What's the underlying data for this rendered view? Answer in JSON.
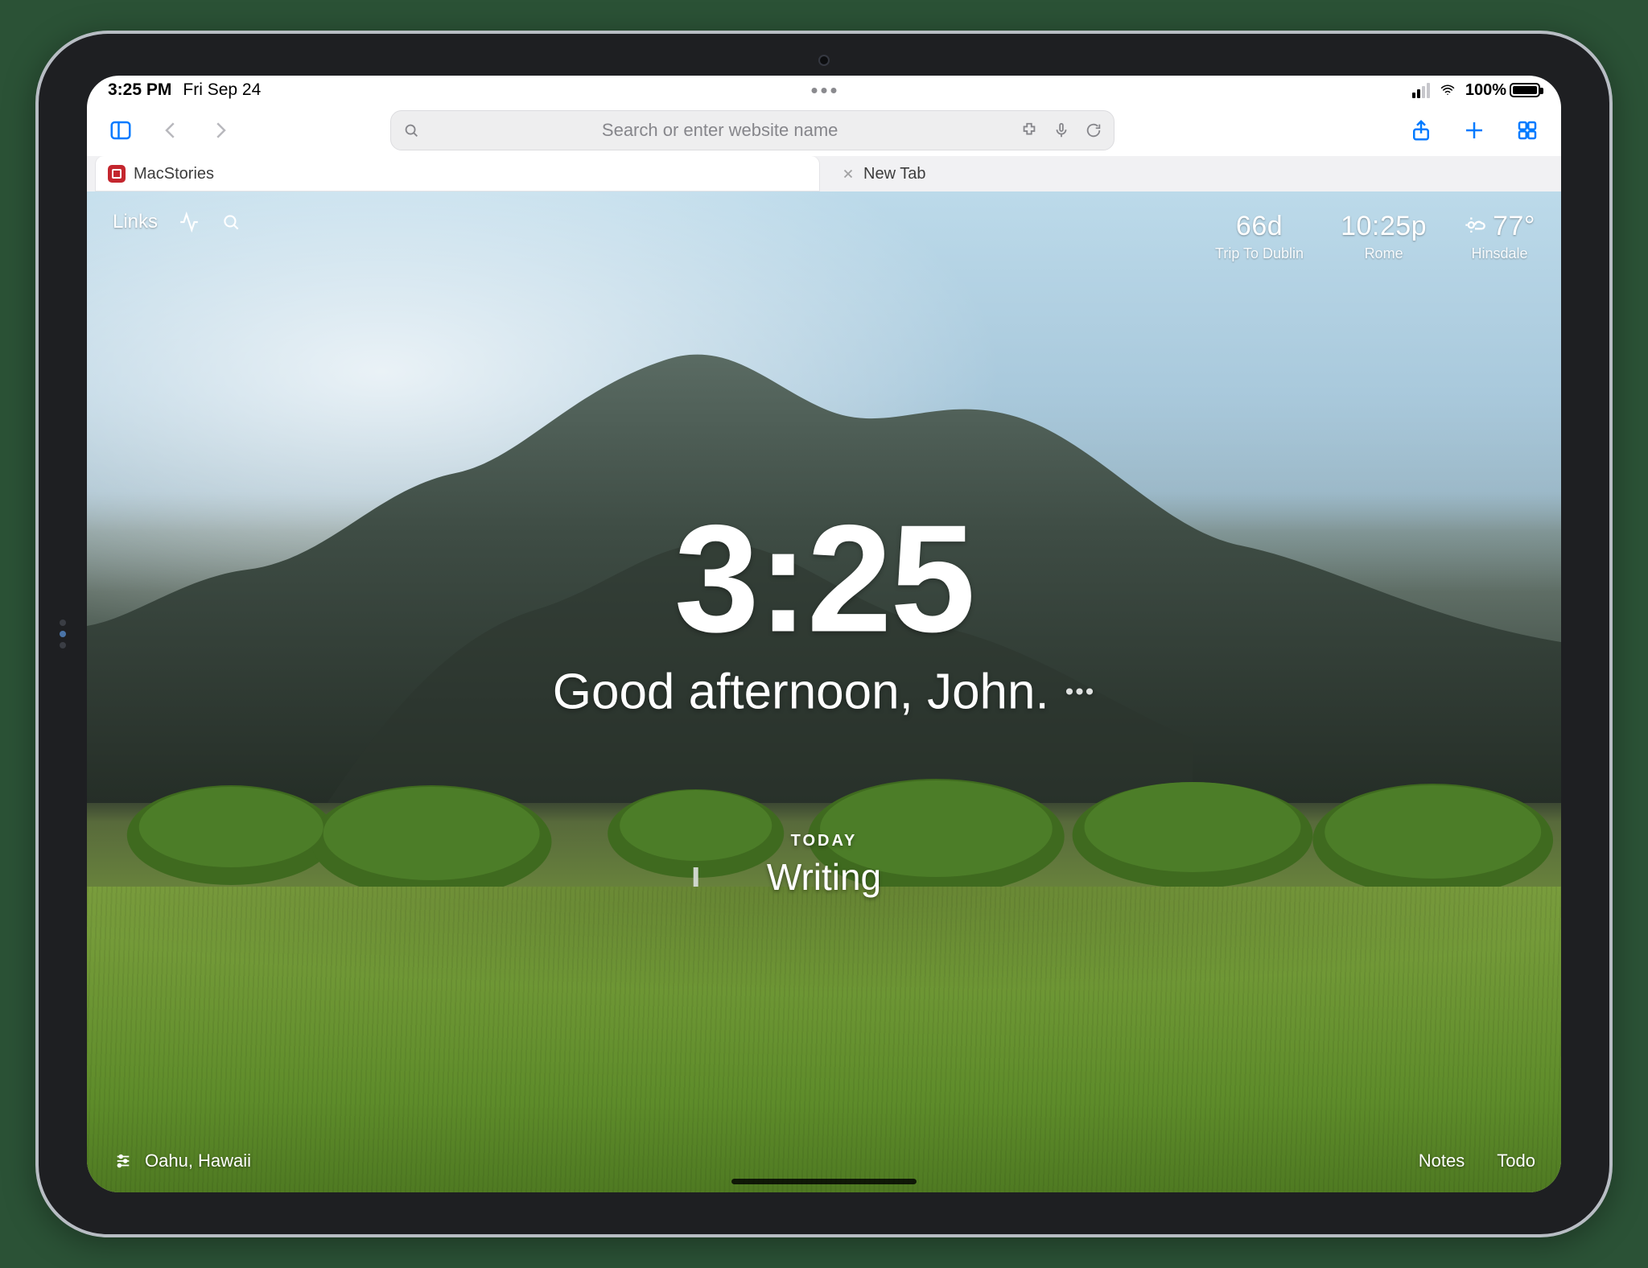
{
  "status_bar": {
    "time": "3:25 PM",
    "date": "Fri Sep 24",
    "battery_pct": "100%"
  },
  "safari": {
    "search_placeholder": "Search or enter website name",
    "tabs": [
      {
        "title": "MacStories"
      },
      {
        "title": "New Tab"
      }
    ]
  },
  "page": {
    "top_left": {
      "links_label": "Links"
    },
    "widgets": {
      "countdown": {
        "value": "66d",
        "label": "Trip To Dublin"
      },
      "clock2": {
        "value": "10:25p",
        "label": "Rome"
      },
      "weather": {
        "value": "77°",
        "label": "Hinsdale"
      }
    },
    "center": {
      "time": "3:25",
      "greeting": "Good afternoon, John."
    },
    "focus": {
      "label": "TODAY",
      "value": "Writing"
    },
    "bottom": {
      "location": "Oahu, Hawaii",
      "right": {
        "notes": "Notes",
        "todo": "Todo"
      }
    }
  }
}
